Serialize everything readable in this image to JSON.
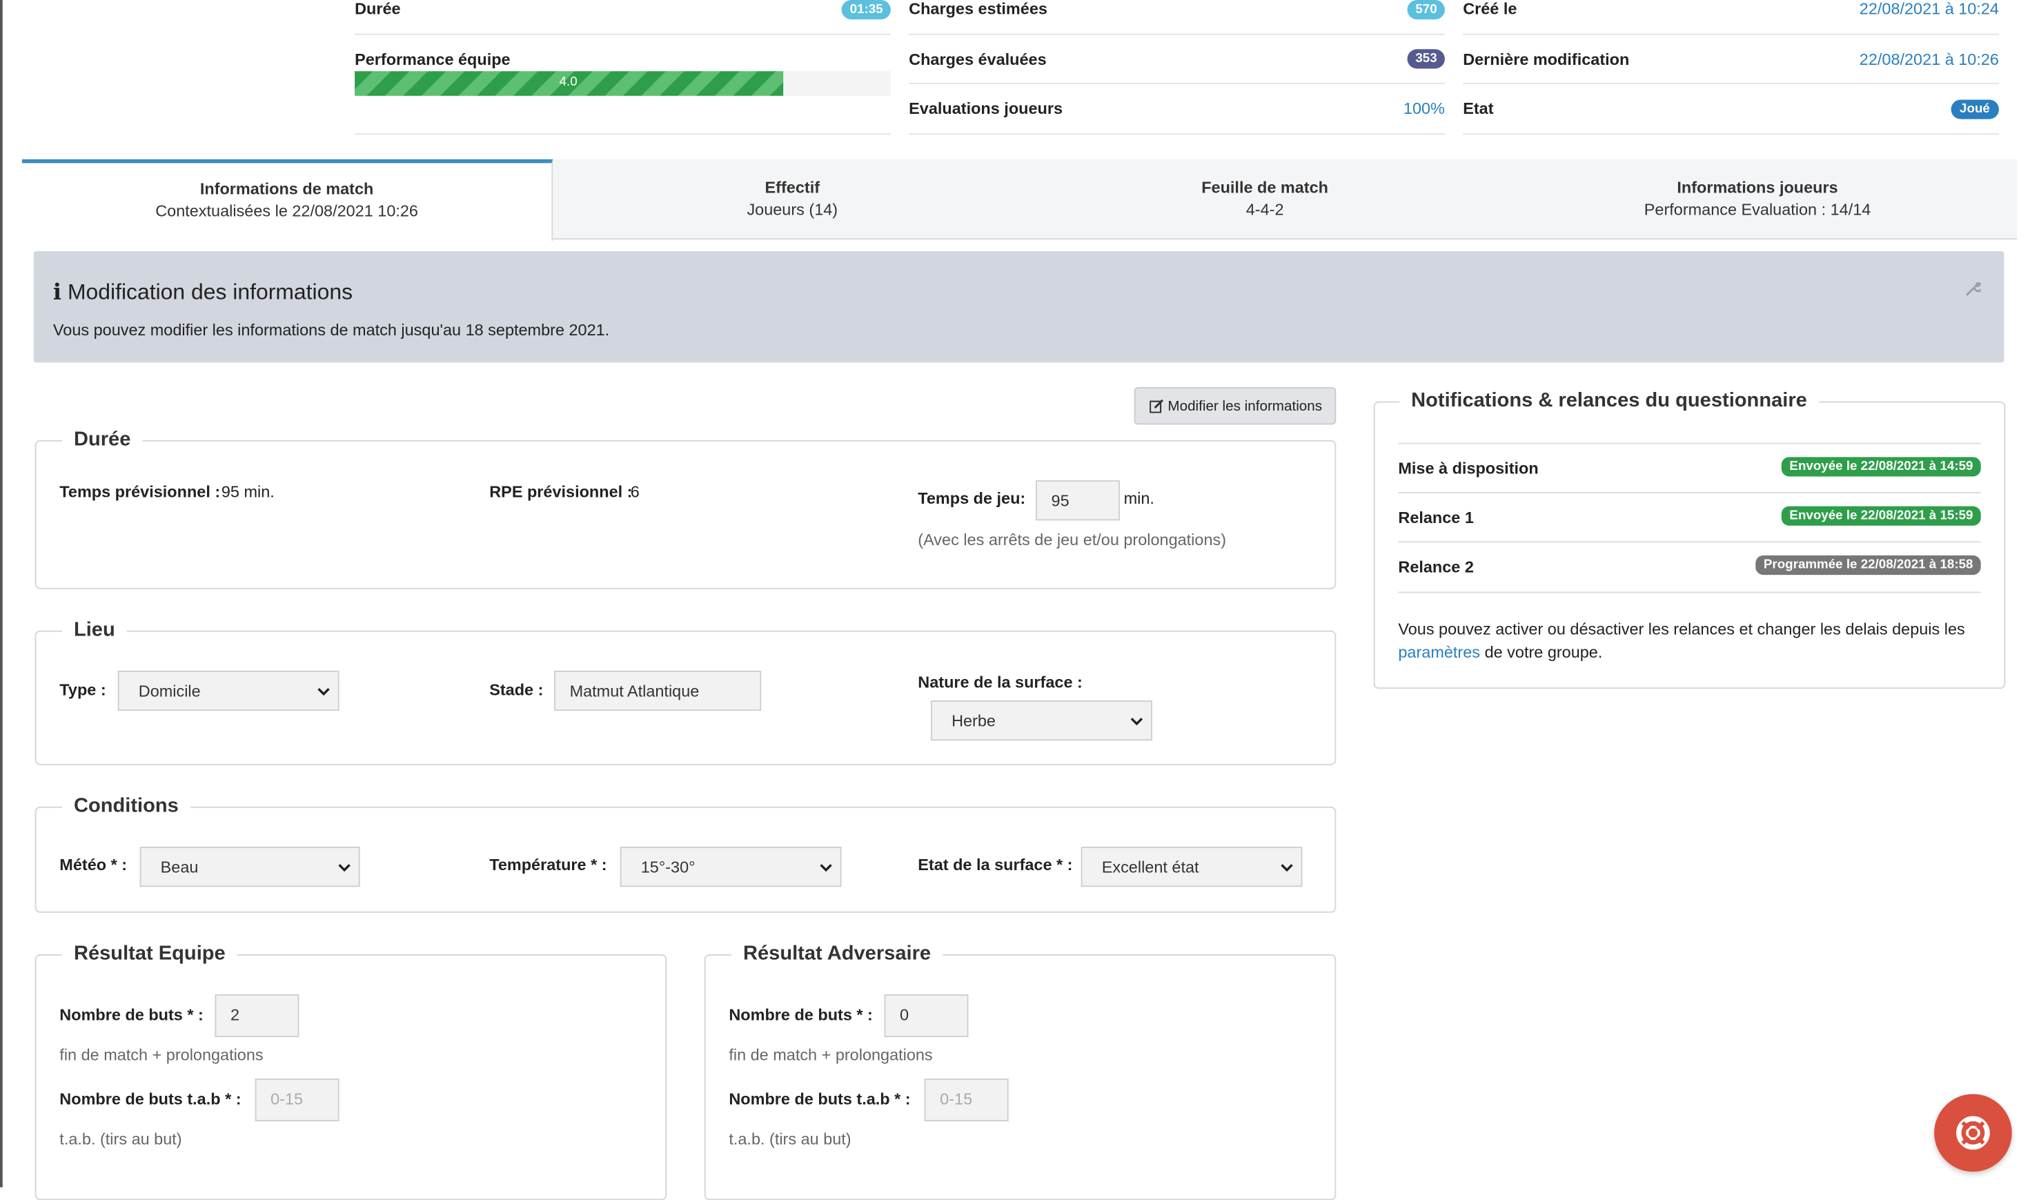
{
  "summary": {
    "duree": {
      "label": "Durée",
      "badge": "01:35",
      "color": "#5bc0de"
    },
    "performance": {
      "label": "Performance équipe",
      "value": "4.0",
      "fill_fraction": 0.8
    },
    "charges_estimees": {
      "label": "Charges estimées",
      "badge": "570",
      "color": "#5bc0de"
    },
    "charges_evaluees": {
      "label": "Charges évaluées",
      "badge": "353",
      "color": "#555b8f"
    },
    "evaluations": {
      "label": "Evaluations joueurs",
      "value": "100%"
    },
    "cree_le": {
      "label": "Créé le",
      "value": "22/08/2021 à 10:24"
    },
    "derniere_modif": {
      "label": "Dernière modification",
      "value": "22/08/2021 à 10:26"
    },
    "etat": {
      "label": "Etat",
      "badge": "Joué",
      "color": "#2a7fbf"
    }
  },
  "tabs": [
    {
      "title": "Informations de match",
      "subtitle": "Contextualisées le 22/08/2021 10:26"
    },
    {
      "title": "Effectif",
      "subtitle": "Joueurs (14)"
    },
    {
      "title": "Feuille de match",
      "subtitle": "4-4-2"
    },
    {
      "title": "Informations joueurs",
      "subtitle": "Performance Evaluation : 14/14"
    }
  ],
  "alert": {
    "title": "Modification des informations",
    "text": "Vous pouvez modifier les informations de match jusqu'au 18 septembre 2021."
  },
  "modify_button": "Modifier les informations",
  "duree": {
    "legend": "Durée",
    "temps_prev_label": "Temps prévisionnel :",
    "temps_prev_value": "95 min.",
    "rpe_label": "RPE prévisionnel :",
    "rpe_value": "6",
    "temps_jeu_label": "Temps de jeu:",
    "temps_jeu_value": "95",
    "unit": "min.",
    "help": "(Avec les arrêts de jeu et/ou prolongations)"
  },
  "lieu": {
    "legend": "Lieu",
    "type_label": "Type :",
    "type_value": "Domicile",
    "stade_label": "Stade :",
    "stade_value": "Matmut Atlantique",
    "surface_label": "Nature de la surface :",
    "surface_value": "Herbe"
  },
  "conditions": {
    "legend": "Conditions",
    "meteo_label": "Météo * :",
    "meteo_value": "Beau",
    "temp_label": "Température * :",
    "temp_value": "15°-30°",
    "etat_label": "Etat de la surface * :",
    "etat_value": "Excellent état"
  },
  "result_team": {
    "legend": "Résultat Equipe",
    "buts_label": "Nombre de buts * :",
    "buts_value": "2",
    "buts_help": "fin de match + prolongations",
    "tab_label": "Nombre de buts t.a.b * :",
    "tab_placeholder": "0-15",
    "tab_help": "t.a.b. (tirs au but)"
  },
  "result_opp": {
    "legend": "Résultat Adversaire",
    "buts_label": "Nombre de buts * :",
    "buts_value": "0",
    "buts_help": "fin de match + prolongations",
    "tab_label": "Nombre de buts t.a.b * :",
    "tab_placeholder": "0-15",
    "tab_help": "t.a.b. (tirs au but)"
  },
  "notifications": {
    "legend": "Notifications & relances du questionnaire",
    "rows": [
      {
        "label": "Mise à disposition",
        "badge": "Envoyée le 22/08/2021 à 14:59",
        "color": "#2e9e4a"
      },
      {
        "label": "Relance 1",
        "badge": "Envoyée le 22/08/2021 à 15:59",
        "color": "#2e9e4a"
      },
      {
        "label": "Relance 2",
        "badge": "Programmée le 22/08/2021 à 18:58",
        "color": "#777777"
      }
    ],
    "text_before": "Vous pouvez activer ou désactiver les relances et changer les delais depuis les",
    "link": "paramètres",
    "text_after": "de votre groupe."
  }
}
